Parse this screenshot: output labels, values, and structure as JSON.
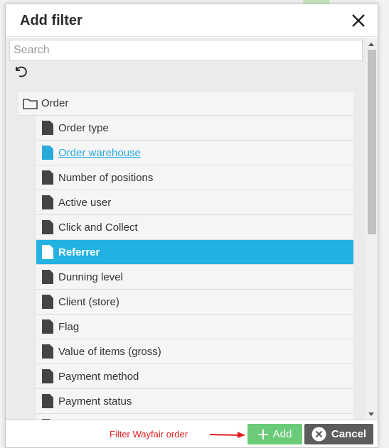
{
  "dialog": {
    "title": "Add filter"
  },
  "search": {
    "placeholder": "Search",
    "value": ""
  },
  "tree": {
    "folder": {
      "label": "Order",
      "icon": "folder-icon"
    },
    "items": [
      {
        "label": "Order type",
        "state": "normal",
        "icon": "document-icon"
      },
      {
        "label": "Order warehouse",
        "state": "link",
        "icon": "document-icon"
      },
      {
        "label": "Number of positions",
        "state": "normal",
        "icon": "document-icon"
      },
      {
        "label": "Active user",
        "state": "normal",
        "icon": "document-icon"
      },
      {
        "label": "Click and Collect",
        "state": "normal",
        "icon": "document-icon"
      },
      {
        "label": "Referrer",
        "state": "selected",
        "icon": "document-icon"
      },
      {
        "label": "Dunning level",
        "state": "normal",
        "icon": "document-icon"
      },
      {
        "label": "Client (store)",
        "state": "normal",
        "icon": "document-icon"
      },
      {
        "label": "Flag",
        "state": "normal",
        "icon": "document-icon"
      },
      {
        "label": "Value of items (gross)",
        "state": "normal",
        "icon": "document-icon"
      },
      {
        "label": "Payment method",
        "state": "normal",
        "icon": "document-icon"
      },
      {
        "label": "Payment status",
        "state": "normal",
        "icon": "document-icon"
      },
      {
        "label": "",
        "state": "normal",
        "icon": "document-icon"
      }
    ]
  },
  "footer": {
    "annotation": "Filter Wayfair order",
    "add_label": "Add",
    "cancel_label": "Cancel"
  },
  "colors": {
    "selected": "#22b2e2",
    "link": "#29a9dc",
    "add_button": "#6ccb78",
    "cancel_button": "#5c5c5c",
    "annotation": "#e02020"
  }
}
